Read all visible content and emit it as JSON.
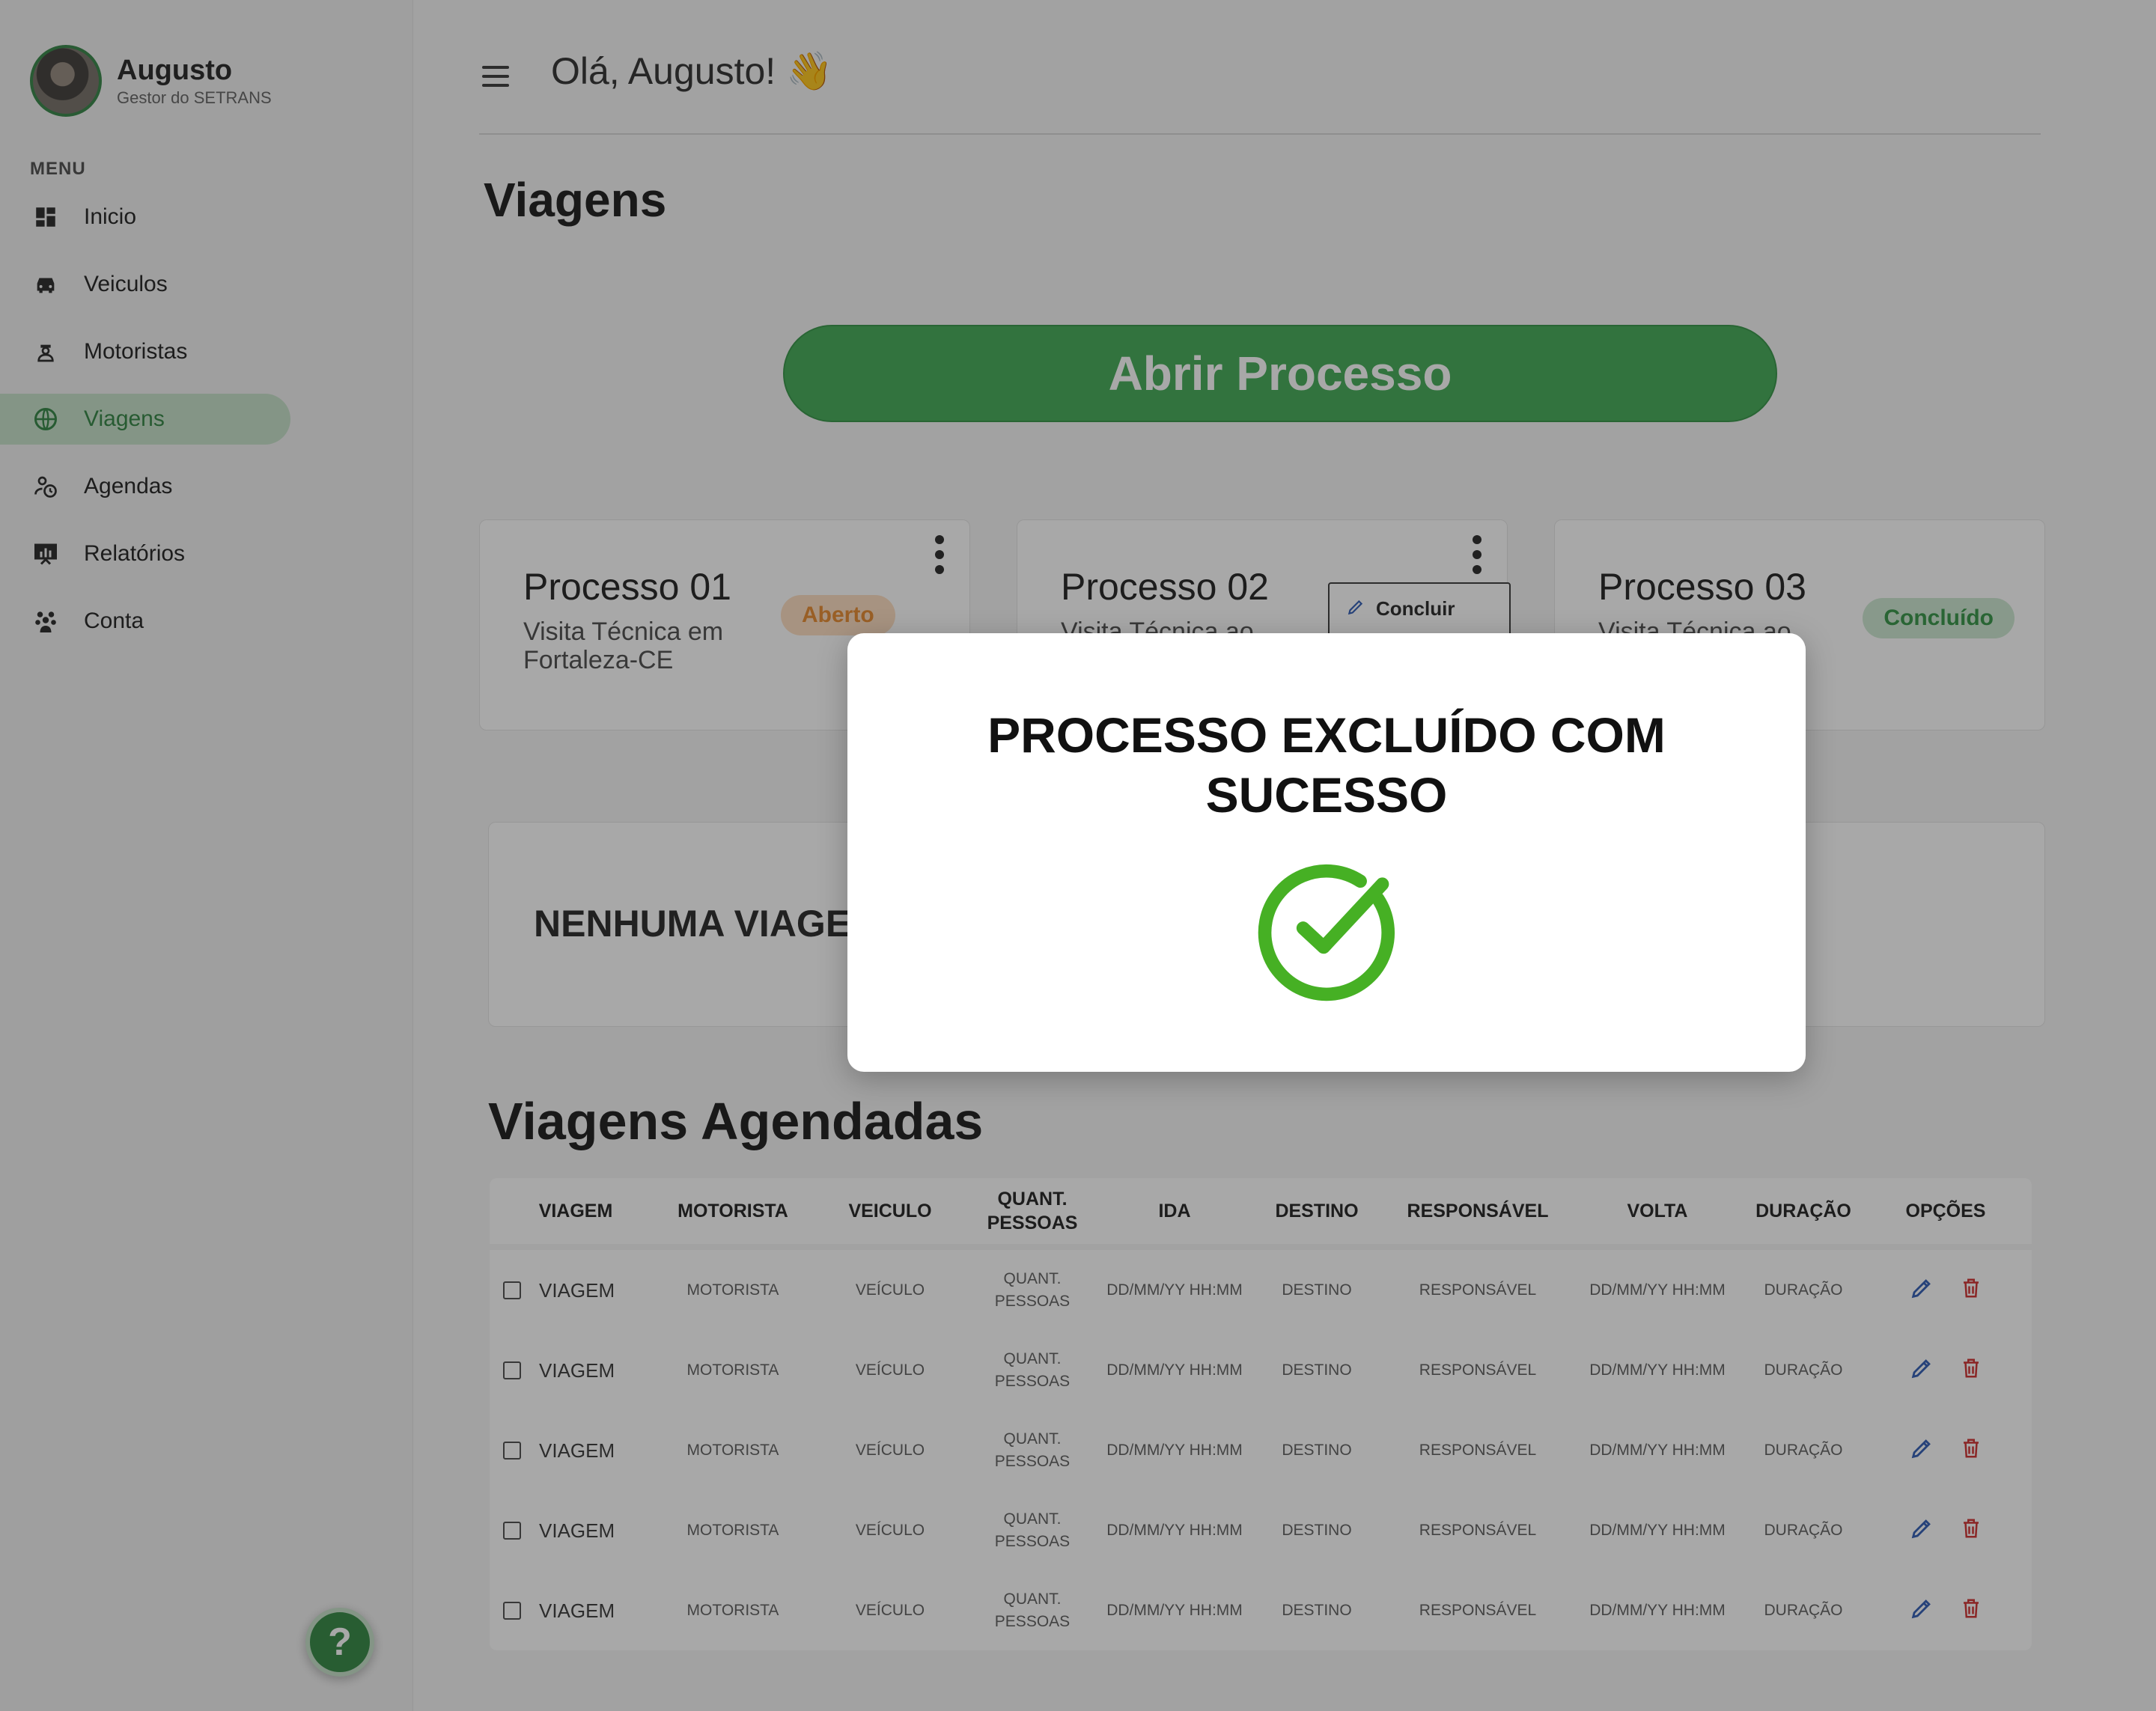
{
  "user": {
    "name": "Augusto",
    "role": "Gestor do SETRANS"
  },
  "sidebar": {
    "menu_label": "MENU",
    "items": [
      {
        "label": "Inicio",
        "icon": "dashboard-icon"
      },
      {
        "label": "Veiculos",
        "icon": "car-icon"
      },
      {
        "label": "Motoristas",
        "icon": "driver-icon"
      },
      {
        "label": "Viagens",
        "icon": "globe-icon",
        "active": true
      },
      {
        "label": "Agendas",
        "icon": "schedule-icon"
      },
      {
        "label": "Relatórios",
        "icon": "report-icon"
      },
      {
        "label": "Conta",
        "icon": "users-icon"
      }
    ],
    "help_label": "?"
  },
  "header": {
    "greeting": "Olá, Augusto! 👋"
  },
  "page": {
    "title": "Viagens",
    "open_button": "Abrir Processo"
  },
  "processes": [
    {
      "title": "Processo 01",
      "subtitle": "Visita Técnica em Fortaleza-CE",
      "status": "Aberto"
    },
    {
      "title": "Processo 02",
      "subtitle": "Visita Técnica ao",
      "status": ""
    },
    {
      "title": "Processo 03",
      "subtitle": "Visita Técnica ao",
      "status": "Concluído"
    }
  ],
  "dropdown": {
    "conclude_label": "Concluir"
  },
  "empty_state": "NENHUMA VIAGEM",
  "scheduled": {
    "title": "Viagens Agendadas",
    "columns": [
      "VIAGEM",
      "MOTORISTA",
      "VEICULO",
      "QUANT. PESSOAS",
      "IDA",
      "DESTINO",
      "RESPONSÁVEL",
      "VOLTA",
      "DURAÇÃO",
      "OPÇÕES"
    ],
    "rows": [
      {
        "viagem": "VIAGEM",
        "motorista": "MOTORISTA",
        "veiculo": "VEÍCULO",
        "pessoas": "QUANT. PESSOAS",
        "ida": "DD/MM/YY HH:MM",
        "destino": "DESTINO",
        "responsavel": "RESPONSÁVEL",
        "volta": "DD/MM/YY HH:MM",
        "duracao": "DURAÇÃO"
      },
      {
        "viagem": "VIAGEM",
        "motorista": "MOTORISTA",
        "veiculo": "VEÍCULO",
        "pessoas": "QUANT. PESSOAS",
        "ida": "DD/MM/YY HH:MM",
        "destino": "DESTINO",
        "responsavel": "RESPONSÁVEL",
        "volta": "DD/MM/YY HH:MM",
        "duracao": "DURAÇÃO"
      },
      {
        "viagem": "VIAGEM",
        "motorista": "MOTORISTA",
        "veiculo": "VEÍCULO",
        "pessoas": "QUANT. PESSOAS",
        "ida": "DD/MM/YY HH:MM",
        "destino": "DESTINO",
        "responsavel": "RESPONSÁVEL",
        "volta": "DD/MM/YY HH:MM",
        "duracao": "DURAÇÃO"
      },
      {
        "viagem": "VIAGEM",
        "motorista": "MOTORISTA",
        "veiculo": "VEÍCULO",
        "pessoas": "QUANT. PESSOAS",
        "ida": "DD/MM/YY HH:MM",
        "destino": "DESTINO",
        "responsavel": "RESPONSÁVEL",
        "volta": "DD/MM/YY HH:MM",
        "duracao": "DURAÇÃO"
      },
      {
        "viagem": "VIAGEM",
        "motorista": "MOTORISTA",
        "veiculo": "VEÍCULO",
        "pessoas": "QUANT. PESSOAS",
        "ida": "DD/MM/YY HH:MM",
        "destino": "DESTINO",
        "responsavel": "RESPONSÁVEL",
        "volta": "DD/MM/YY HH:MM",
        "duracao": "DURAÇÃO"
      }
    ]
  },
  "modal": {
    "message": "PROCESSO EXCLUÍDO COM SUCESSO",
    "icon": "check-circle-icon"
  },
  "colors": {
    "accent": "#4caf5f",
    "accent_light": "#c9e2cc",
    "open": "#e8903b",
    "edit": "#3a64b8",
    "delete": "#d23b3b",
    "success": "#46b024"
  }
}
